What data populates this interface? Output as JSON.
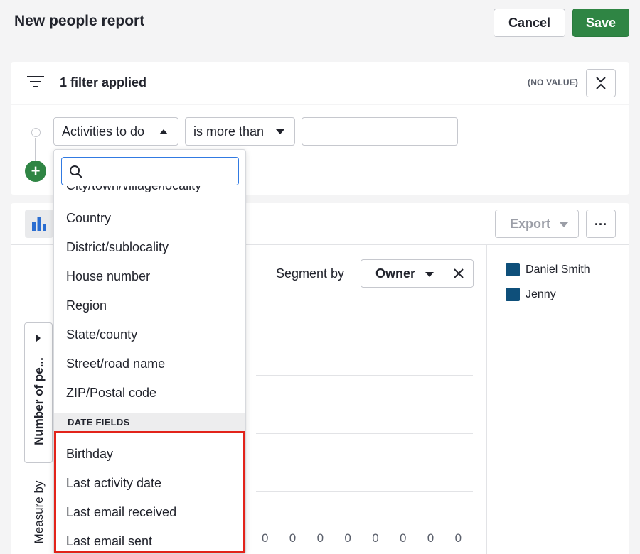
{
  "header": {
    "title": "New people report",
    "cancel_label": "Cancel",
    "save_label": "Save"
  },
  "filters": {
    "summary": "1 filter applied",
    "no_value_label": "(NO VALUE)",
    "rule": {
      "field": "Activities to do",
      "operator": "is more than",
      "value": ""
    }
  },
  "dropdown": {
    "search_placeholder": "",
    "partial_item": "City/town/village/locality",
    "items": [
      "Country",
      "District/sublocality",
      "House number",
      "Region",
      "State/county",
      "Street/road name",
      "ZIP/Postal code"
    ],
    "section_label": "DATE FIELDS",
    "date_items": [
      "Birthday",
      "Last activity date",
      "Last email received",
      "Last email sent"
    ]
  },
  "chart": {
    "export_label": "Export",
    "more_label": "...",
    "segment_label": "Segment by",
    "segment_value": "Owner",
    "measure_value": "Number of pe...",
    "measure_by_label": "Measure by",
    "zero_labels": [
      "0",
      "0",
      "0",
      "0",
      "0",
      "0",
      "0",
      "0"
    ]
  },
  "legend": {
    "items": [
      {
        "name": "Daniel Smith",
        "color": "#0e4f7a"
      },
      {
        "name": "Jenny",
        "color": "#0e4f7a"
      }
    ]
  },
  "colors": {
    "primary_green": "#2f8544",
    "highlight_red": "#e2231a",
    "focus_blue": "#317ae2",
    "series_color": "#0e4f7a"
  },
  "icons": {
    "filter": "filter-lines-icon",
    "collapse": "collapse-vertical-icon",
    "chart_type": "bar-chart-icon",
    "search": "search-icon",
    "add": "plus-icon",
    "clear": "close-icon"
  }
}
